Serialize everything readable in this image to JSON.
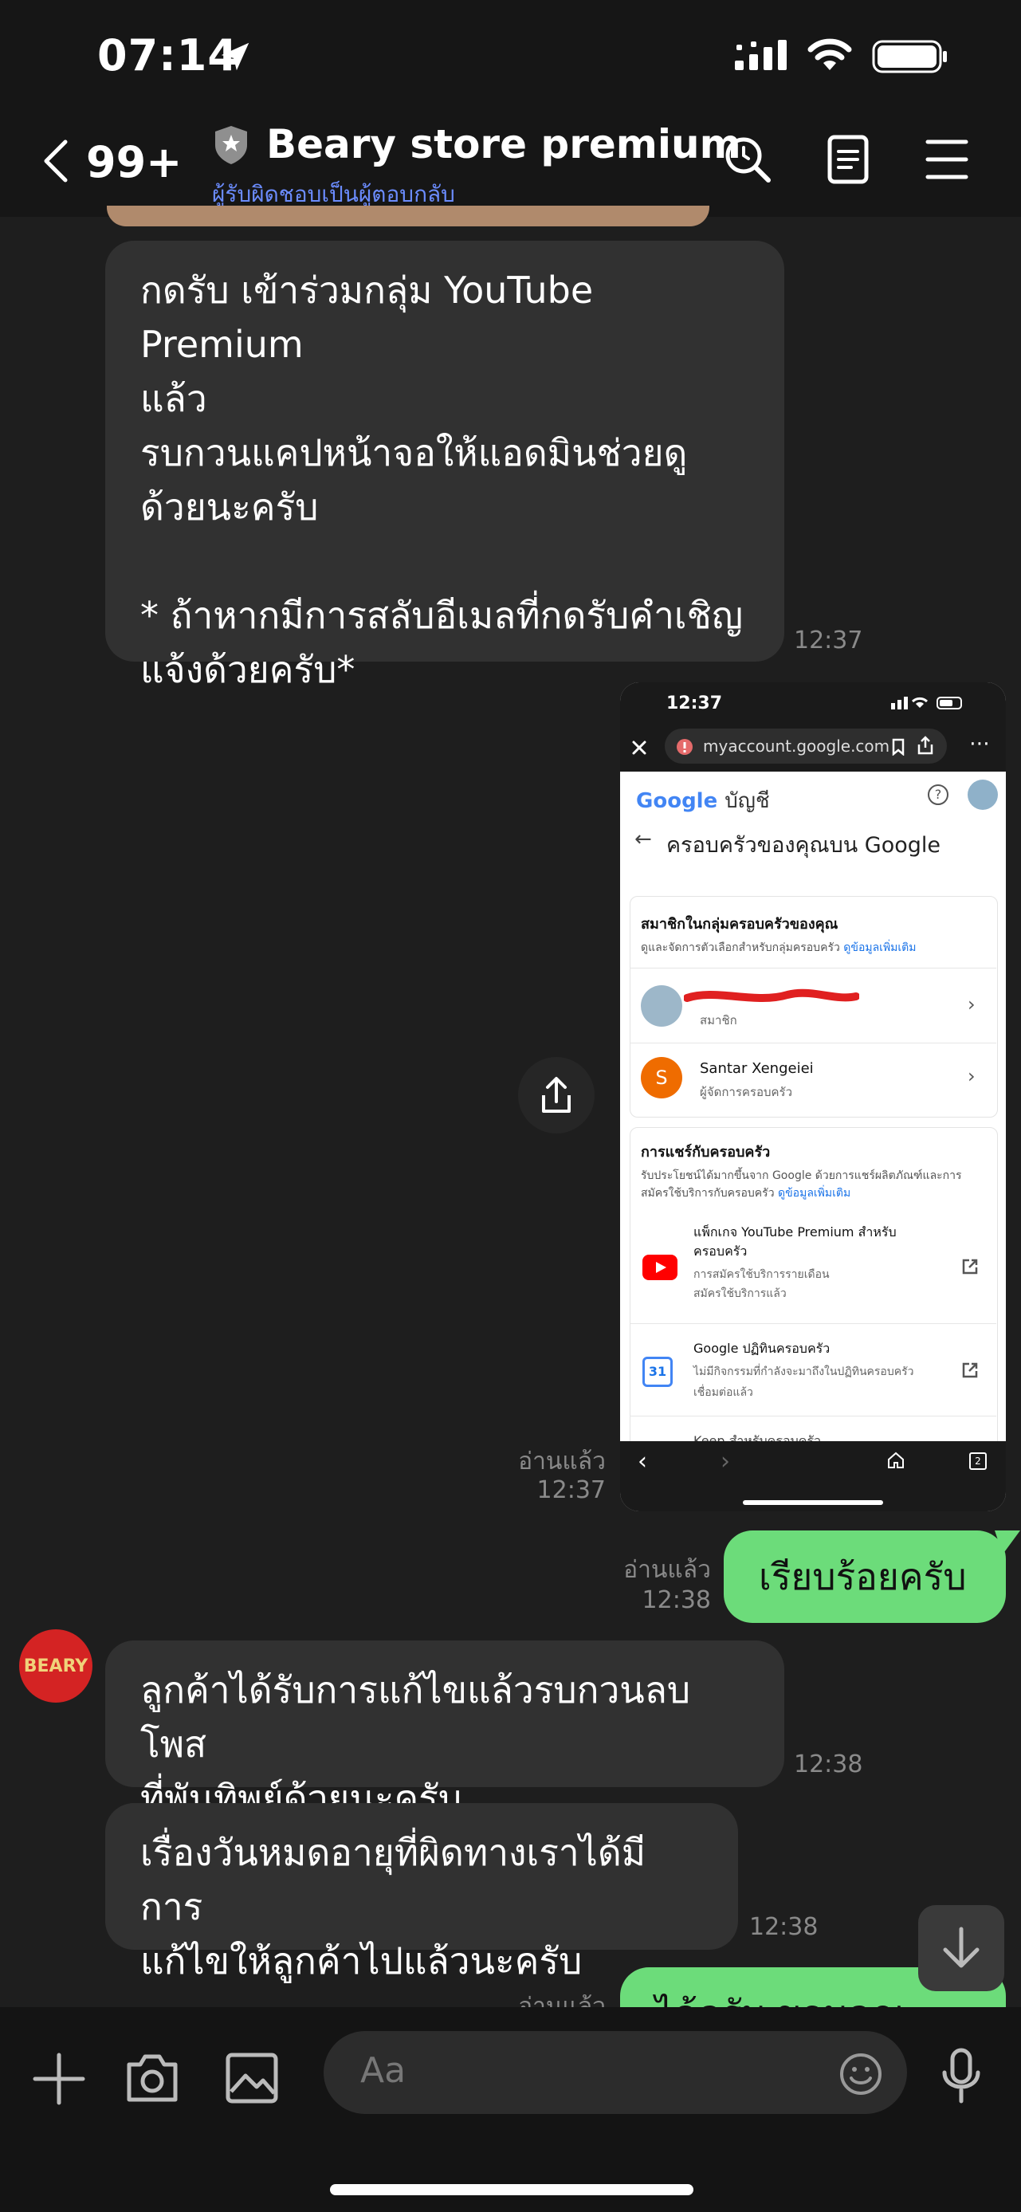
{
  "status_bar": {
    "time": "07:14"
  },
  "header": {
    "back_count": "99+",
    "title": "Beary store premium",
    "subtitle": "ผู้รับผิดชอบเป็นผู้ตอบกลับ"
  },
  "messages": {
    "m1": {
      "text": "กดรับ เข้าร่วมกลุ่ม YouTube Premium\nแล้ว\nรบกวนแคปหน้าจอให้แอดมินช่วยดู\nด้วยนะครับ\n\n* ถ้าหากมีการสลับอีเมลที่กดรับคำเชิญ\nแจ้งด้วยครับ*",
      "time": "12:37"
    },
    "m2": {
      "read": "อ่านแล้ว",
      "time": "12:37"
    },
    "m3": {
      "text": "เรียบร้อยครับ",
      "read": "อ่านแล้ว",
      "time": "12:38"
    },
    "m4": {
      "text": "ลูกค้าได้รับการแก้ไขแล้วรบกวนลบโพส\nที่พันทิพย์ด้วยนะครับ",
      "time": "12:38"
    },
    "m5": {
      "text": "เรื่องวันหมดอายุที่ผิดทางเราได้มีการ\nแก้ไขให้ลูกค้าไปแล้วนะครับ",
      "time": "12:38"
    },
    "m6": {
      "text": "ได้ครับ ขอบคุณครับ",
      "read": "อ่านแล้ว"
    }
  },
  "avatar": {
    "text": "BEARY"
  },
  "screenshot": {
    "time": "12:37",
    "url": "myaccount.google.com",
    "google_brand": "Google",
    "account_label": "บัญชี",
    "page_title": "ครอบครัวของคุณบน Google",
    "members_heading": "สมาชิกในกลุ่มครอบครัวของคุณ",
    "members_desc": "ดูและจัดการตัวเลือกสำหรับกลุ่มครอบครัว",
    "learn_more": "ดูข้อมูลเพิ่มเติม",
    "member1_role": "สมาชิก",
    "member2_initial": "S",
    "member2_name": "Santar Xengeiei",
    "member2_role": "ผู้จัดการครอบครัว",
    "sharing_heading": "การแชร์กับครอบครัว",
    "sharing_desc1": "รับประโยชน์ได้มากขึ้นจาก Google ด้วยการแชร์ผลิตภัณฑ์และการ",
    "sharing_desc2": "สมัครใช้บริการกับครอบครัว",
    "yt_title1": "แพ็กเกจ YouTube Premium สำหรับ",
    "yt_title2": "ครอบครัว",
    "yt_sub1": "การสมัครใช้บริการรายเดือน",
    "yt_sub2": "สมัครใช้บริการแล้ว",
    "cal_title": "Google ปฏิทินครอบครัว",
    "cal_sub1": "ไม่มีกิจกรรมที่กำลังจะมาถึงในปฏิทินครอบครัว",
    "cal_sub2": "เชื่อมต่อแล้ว",
    "cal_icon_text": "31",
    "keep_title": "Keep สำหรับครอบครัว",
    "tabs_count": "2"
  },
  "input": {
    "placeholder": "Aa"
  },
  "colors": {
    "accent": "#6cdc7a",
    "bubble_other": "#313131",
    "background": "#1e1e1e",
    "link": "#6b8cff"
  }
}
